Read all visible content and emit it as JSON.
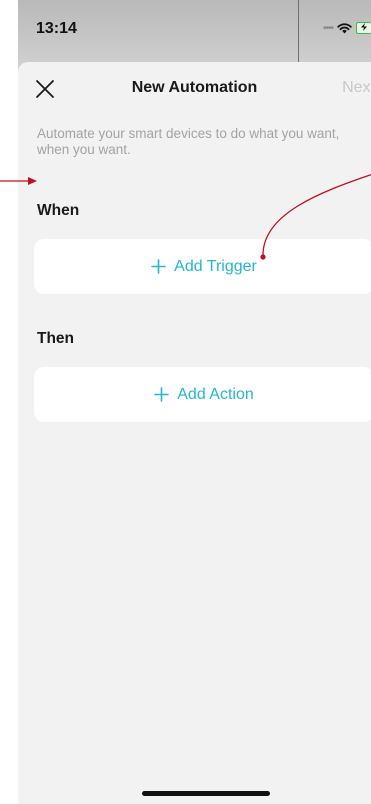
{
  "status_bar": {
    "time": "13:14"
  },
  "header": {
    "title": "New Automation",
    "next_label": "Next",
    "close_icon": "close-icon"
  },
  "description": "Automate your smart devices to do what you want, when you want.",
  "when_section": {
    "label": "When",
    "add_trigger_label": "Add Trigger"
  },
  "then_section": {
    "label": "Then",
    "add_action_label": "Add Action"
  },
  "colors": {
    "accent": "#24b7cf",
    "annotation": "#c0101a",
    "disabled_text": "#c8c8c8",
    "sheet_background": "#f2f2f2"
  }
}
